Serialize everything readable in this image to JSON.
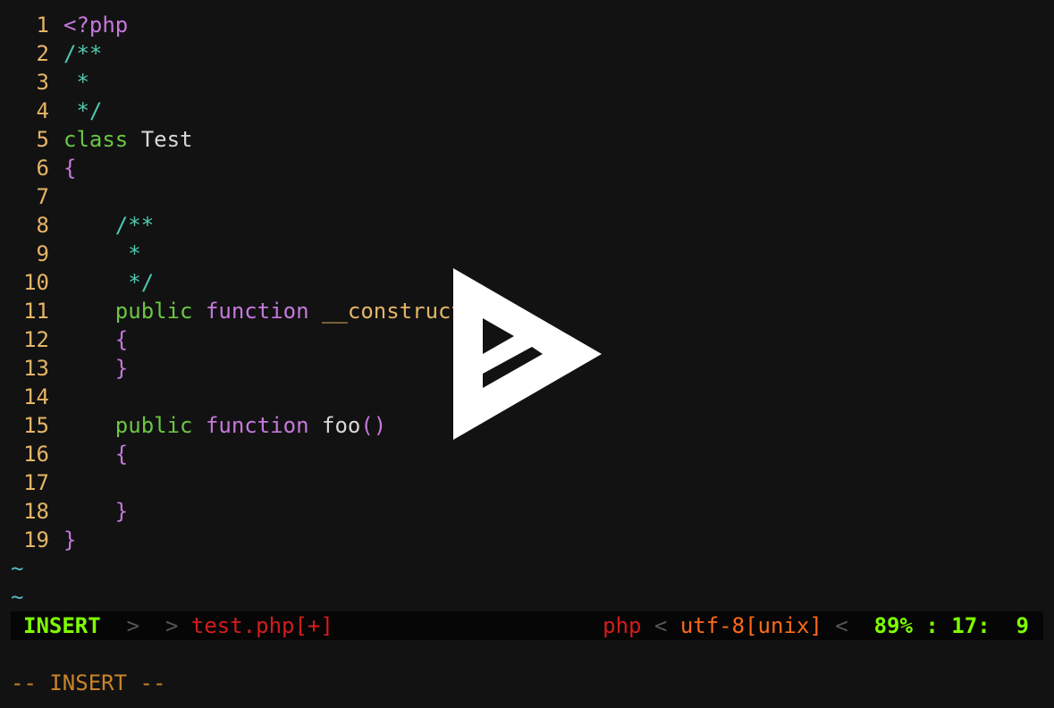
{
  "editor": {
    "lines": [
      {
        "n": "1",
        "parts": [
          {
            "t": "<?php",
            "c": "ph"
          }
        ]
      },
      {
        "n": "2",
        "parts": [
          {
            "t": "/**",
            "c": "cm"
          }
        ]
      },
      {
        "n": "3",
        "parts": [
          {
            "t": " *",
            "c": "cm"
          }
        ]
      },
      {
        "n": "4",
        "parts": [
          {
            "t": " */",
            "c": "cm"
          }
        ]
      },
      {
        "n": "5",
        "parts": [
          {
            "t": "class",
            "c": "kw"
          },
          {
            "t": " Test",
            "c": "cl"
          }
        ]
      },
      {
        "n": "6",
        "parts": [
          {
            "t": "{",
            "c": "br"
          }
        ]
      },
      {
        "n": "7",
        "parts": []
      },
      {
        "n": "8",
        "parts": [
          {
            "t": "    /**",
            "c": "cm"
          }
        ]
      },
      {
        "n": "9",
        "parts": [
          {
            "t": "     *",
            "c": "cm"
          }
        ]
      },
      {
        "n": "10",
        "parts": [
          {
            "t": "     */",
            "c": "cm"
          }
        ]
      },
      {
        "n": "11",
        "parts": [
          {
            "t": "    public",
            "c": "kw"
          },
          {
            "t": " function",
            "c": "fn"
          },
          {
            "t": " __construct",
            "c": "mg"
          }
        ]
      },
      {
        "n": "12",
        "parts": [
          {
            "t": "    {",
            "c": "br"
          }
        ]
      },
      {
        "n": "13",
        "parts": [
          {
            "t": "    }",
            "c": "br"
          }
        ]
      },
      {
        "n": "14",
        "parts": []
      },
      {
        "n": "15",
        "parts": [
          {
            "t": "    public",
            "c": "kw"
          },
          {
            "t": " function",
            "c": "fn"
          },
          {
            "t": " foo",
            "c": "cl"
          },
          {
            "t": "()",
            "c": "br"
          }
        ]
      },
      {
        "n": "16",
        "parts": [
          {
            "t": "    {",
            "c": "br"
          }
        ]
      },
      {
        "n": "17",
        "parts": []
      },
      {
        "n": "18",
        "parts": [
          {
            "t": "    }",
            "c": "br"
          }
        ]
      },
      {
        "n": "19",
        "parts": [
          {
            "t": "}",
            "c": "br"
          }
        ]
      }
    ],
    "tildes": [
      "~",
      "~"
    ]
  },
  "statusline": {
    "mode": "INSERT",
    "sep_right": ">",
    "filename": "test.php[+]",
    "filetype": "php",
    "sep_left": "<",
    "encoding": "utf-8[unix]",
    "position": "89% : 17:  9"
  },
  "cmdline": {
    "text": "-- INSERT --"
  },
  "overlay": {
    "icon": "asciinema-play-icon",
    "color": "#ffffff"
  }
}
